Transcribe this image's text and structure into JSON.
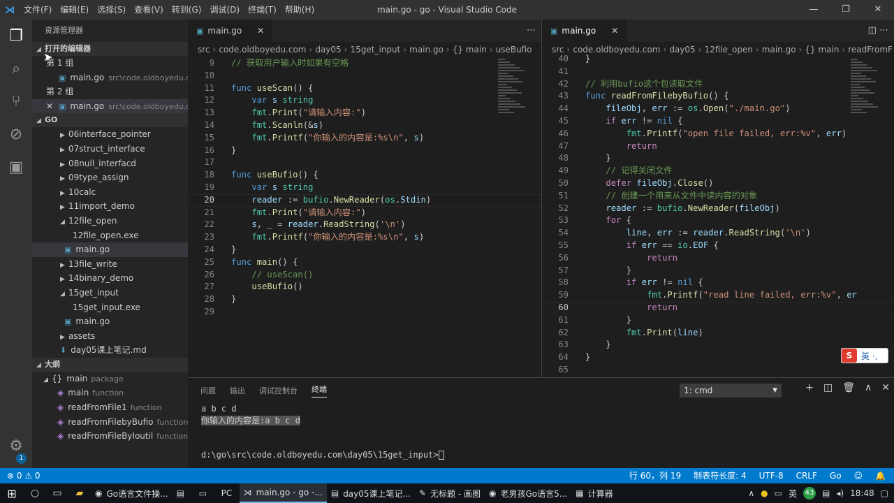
{
  "window": {
    "title": "main.go - go - Visual Studio Code",
    "controls": [
      "—",
      "❐",
      "✕"
    ]
  },
  "menu": [
    "文件(F)",
    "编辑(E)",
    "选择(S)",
    "查看(V)",
    "转到(G)",
    "调试(D)",
    "终端(T)",
    "帮助(H)"
  ],
  "sidebar": {
    "title": "资源管理器",
    "open_editors": {
      "label": "打开的编辑器",
      "group1": "第 1 组",
      "group2": "第 2 组",
      "file": "main.go",
      "path": "src\\code.oldboyedu.com..."
    },
    "workspace": {
      "label": "GO",
      "items": [
        {
          "name": "06interface_pointer",
          "type": "folder",
          "depth": 1
        },
        {
          "name": "07struct_interface",
          "type": "folder",
          "depth": 1
        },
        {
          "name": "08null_interfacd",
          "type": "folder",
          "depth": 1
        },
        {
          "name": "09type_assign",
          "type": "folder",
          "depth": 1
        },
        {
          "name": "10calc",
          "type": "folder",
          "depth": 1
        },
        {
          "name": "11import_demo",
          "type": "folder",
          "depth": 1
        },
        {
          "name": "12file_open",
          "type": "folder-open",
          "depth": 1
        },
        {
          "name": "12file_open.exe",
          "type": "file",
          "depth": 2
        },
        {
          "name": "main.go",
          "type": "go",
          "depth": 2,
          "selected": true
        },
        {
          "name": "13file_write",
          "type": "folder",
          "depth": 1
        },
        {
          "name": "14binary_demo",
          "type": "folder",
          "depth": 1
        },
        {
          "name": "15get_input",
          "type": "folder-open",
          "depth": 1
        },
        {
          "name": "15get_input.exe",
          "type": "file",
          "depth": 2
        },
        {
          "name": "main.go",
          "type": "go",
          "depth": 2
        },
        {
          "name": "assets",
          "type": "folder",
          "depth": 1
        },
        {
          "name": "day05课上笔记.md",
          "type": "md",
          "depth": 1
        }
      ]
    },
    "outline": {
      "label": "大纲",
      "root": "main",
      "root_type": "package",
      "items": [
        {
          "name": "main",
          "type": "function"
        },
        {
          "name": "readFromFile1",
          "type": "function"
        },
        {
          "name": "readFromFilebyBufio",
          "type": "function"
        },
        {
          "name": "readFromFileByIoutil",
          "type": "function"
        }
      ]
    }
  },
  "left_editor": {
    "tab": "main.go",
    "tab_close": "✕",
    "actions": "⋯",
    "breadcrumb": [
      "src",
      "code.oldboyedu.com",
      "day05",
      "15get_input",
      "main.go",
      "{} main",
      "useBufio"
    ],
    "current_line": 20,
    "lines": [
      {
        "n": 9,
        "html": "<span class='c'>// 获取用户输入时如果有空格</span>"
      },
      {
        "n": 10,
        "html": ""
      },
      {
        "n": 11,
        "html": "<span class='k'>func</span> <span class='f'>useScan</span>() {"
      },
      {
        "n": 12,
        "html": "    <span class='k'>var</span> <span class='v'>s</span> <span class='t'>string</span>"
      },
      {
        "n": 13,
        "html": "    <span class='t'>fmt</span>.<span class='f'>Print</span>(<span class='s'>\"请输入内容:\"</span>)"
      },
      {
        "n": 14,
        "html": "    <span class='t'>fmt</span>.<span class='f'>Scanln</span>(&amp;<span class='v'>s</span>)"
      },
      {
        "n": 15,
        "html": "    <span class='t'>fmt</span>.<span class='f'>Printf</span>(<span class='s'>\"你输入的内容是:%s\\n\"</span>, <span class='v'>s</span>)"
      },
      {
        "n": 16,
        "html": "}"
      },
      {
        "n": 17,
        "html": ""
      },
      {
        "n": 18,
        "html": "<span class='k'>func</span> <span class='f'>useBufio</span>() {"
      },
      {
        "n": 19,
        "html": "    <span class='k'>var</span> <span class='v'>s</span> <span class='t'>string</span>"
      },
      {
        "n": 20,
        "html": "    <span class='v'>reader</span> := <span class='t'>bufio</span>.<span class='f'>NewReader</span>(<span class='t'>os</span>.<span class='v'>Stdin</span>)"
      },
      {
        "n": 21,
        "html": "    <span class='t'>fmt</span>.<span class='f'>Print</span>(<span class='s'>\"请输入内容:\"</span>)"
      },
      {
        "n": 22,
        "html": "    <span class='v'>s</span>, <span class='v'>_</span> = <span class='v'>reader</span>.<span class='f'>ReadString</span>(<span class='s'>'\\n'</span>)"
      },
      {
        "n": 23,
        "html": "    <span class='t'>fmt</span>.<span class='f'>Printf</span>(<span class='s'>\"你输入的内容是:%s\\n\"</span>, <span class='v'>s</span>)"
      },
      {
        "n": 24,
        "html": "}"
      },
      {
        "n": 25,
        "html": "<span class='k'>func</span> <span class='f'>main</span>() {"
      },
      {
        "n": 26,
        "html": "    <span class='c'>// useScan()</span>"
      },
      {
        "n": 27,
        "html": "    <span class='f'>useBufio</span>()"
      },
      {
        "n": 28,
        "html": "}"
      },
      {
        "n": 29,
        "html": ""
      }
    ]
  },
  "right_editor": {
    "tab": "main.go",
    "tab_close": "✕",
    "actions": "◫  ⋯",
    "breadcrumb": [
      "src",
      "code.oldboyedu.com",
      "day05",
      "12file_open",
      "main.go",
      "{} main",
      "readFromF"
    ],
    "current_line": 60,
    "lines": [
      {
        "n": 40,
        "html": "}"
      },
      {
        "n": 41,
        "html": ""
      },
      {
        "n": 42,
        "html": "<span class='c'>// 利用bufio这个包读取文件</span>"
      },
      {
        "n": 43,
        "html": "<span class='k'>func</span> <span class='f'>readFromFilebyBufio</span>() {"
      },
      {
        "n": 44,
        "html": "    <span class='v'>fileObj</span>, <span class='v'>err</span> := <span class='t'>os</span>.<span class='f'>Open</span>(<span class='s'>\"./main.go\"</span>)"
      },
      {
        "n": 45,
        "html": "    <span class='ctl'>if</span> <span class='v'>err</span> != <span class='k'>nil</span> {"
      },
      {
        "n": 46,
        "html": "        <span class='t'>fmt</span>.<span class='f'>Printf</span>(<span class='s'>\"open file failed, err:%v\"</span>, <span class='v'>err</span>)"
      },
      {
        "n": 47,
        "html": "        <span class='ctl'>return</span>"
      },
      {
        "n": 48,
        "html": "    }"
      },
      {
        "n": 49,
        "html": "    <span class='c'>// 记得关闭文件</span>"
      },
      {
        "n": 50,
        "html": "    <span class='ctl'>defer</span> <span class='v'>fileObj</span>.<span class='f'>Close</span>()"
      },
      {
        "n": 51,
        "html": "    <span class='c'>// 创建一个用来从文件中读内容的对象</span>"
      },
      {
        "n": 52,
        "html": "    <span class='v'>reader</span> := <span class='t'>bufio</span>.<span class='f'>NewReader</span>(<span class='v'>fileObj</span>)"
      },
      {
        "n": 53,
        "html": "    <span class='ctl'>for</span> {"
      },
      {
        "n": 54,
        "html": "        <span class='v'>line</span>, <span class='v'>err</span> := <span class='v'>reader</span>.<span class='f'>ReadString</span>(<span class='s'>'\\n'</span>)"
      },
      {
        "n": 55,
        "html": "        <span class='ctl'>if</span> <span class='v'>err</span> == <span class='t'>io</span>.<span class='v'>EOF</span> {"
      },
      {
        "n": 56,
        "html": "            <span class='ctl'>return</span>"
      },
      {
        "n": 57,
        "html": "        }"
      },
      {
        "n": 58,
        "html": "        <span class='ctl'>if</span> <span class='v'>err</span> != <span class='k'>nil</span> {"
      },
      {
        "n": 59,
        "html": "            <span class='t'>fmt</span>.<span class='f'>Printf</span>(<span class='s'>\"read line failed, err:%v\"</span>, <span class='v'>er</span>"
      },
      {
        "n": 60,
        "html": "            <span class='ctl'>return</span>"
      },
      {
        "n": 61,
        "html": "        }"
      },
      {
        "n": 62,
        "html": "        <span class='t'>fmt</span>.<span class='f'>Print</span>(<span class='v'>line</span>)"
      },
      {
        "n": 63,
        "html": "    }"
      },
      {
        "n": 64,
        "html": "}"
      },
      {
        "n": 65,
        "html": ""
      }
    ]
  },
  "panel": {
    "tabs": [
      "问题",
      "输出",
      "调试控制台",
      "终端"
    ],
    "active_tab": "终端",
    "terminal_select": "1: cmd",
    "actions": [
      "+",
      "◫",
      "🗑",
      "∧",
      "✕"
    ],
    "lines": [
      "a b c d",
      "你输入的内容是:a b c d",
      "",
      "",
      "d:\\go\\src\\code.oldboyedu.com\\day05\\15get_input>"
    ]
  },
  "status": {
    "errors": "⊗ 0 ⚠ 0",
    "cursor": "行 60，列 19",
    "tab": "制表符长度: 4",
    "encoding": "UTF-8",
    "eol": "CRLF",
    "lang": "Go",
    "smile": "☺",
    "bell": "🔔"
  },
  "ime": {
    "logo": "S",
    "text": "英 ·,"
  },
  "taskbar": {
    "apps": [
      {
        "icon": "◉",
        "label": "Go语言文件操..."
      },
      {
        "icon": "▤",
        "label": ""
      },
      {
        "icon": "▭",
        "label": ""
      },
      {
        "icon": "PC",
        "label": ""
      },
      {
        "icon": "⋊",
        "label": "main.go - go -...",
        "active": true
      },
      {
        "icon": "▤",
        "label": "day05课上笔记..."
      },
      {
        "icon": "✎",
        "label": "无标题 - 画图"
      },
      {
        "icon": "◉",
        "label": "老男孩Go语言5..."
      },
      {
        "icon": "▦",
        "label": "计算器"
      }
    ],
    "tray": {
      "lang": "英",
      "temp": "43",
      "time": "18:48"
    }
  }
}
